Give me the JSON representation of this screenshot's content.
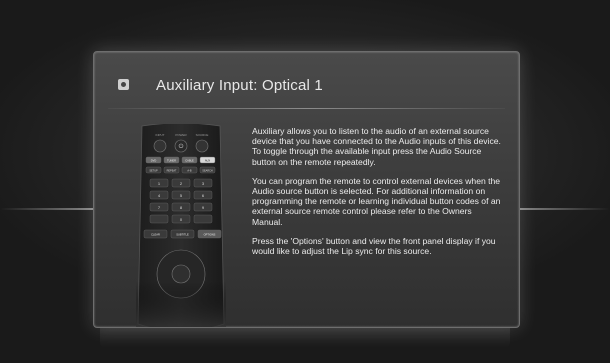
{
  "dialog": {
    "icon": "optical-input-icon",
    "title": "Auxiliary Input: Optical 1",
    "paragraphs": [
      "Auxiliary allows you to listen to the audio of an external source device that you have connected to the Audio inputs of this device. To toggle through the available input press the Audio Source button on the remote repeatedly.",
      "You can program the remote to control external devices when the Audio source button is selected. For additional information on programming the remote or learning individual button codes of an external source remote control please refer to the Owners Manual.",
      "Press the 'Options' button and view the front panel display if you would like to adjust the Lip sync for this source."
    ],
    "remote_image": "remote-control-image",
    "remote_buttons": {
      "top_labels": [
        "INPUT",
        "POWER",
        "SOURCE"
      ],
      "source_row": [
        "DVD",
        "TUNER",
        "CABLE",
        "AUX"
      ],
      "function_row": [
        "SETUP",
        "REPEAT",
        "A-B",
        "SEARCH"
      ],
      "numbers": [
        "1",
        "2",
        "3",
        "4",
        "5",
        "6",
        "7",
        "8",
        "9",
        "",
        "0",
        ""
      ],
      "bottom_row": [
        "CLEAR",
        "SUBTITLE",
        "OPTIONS"
      ]
    }
  },
  "colors": {
    "background": "#1b1b1b",
    "panel": "#3d3d3d",
    "text": "#ececec"
  }
}
